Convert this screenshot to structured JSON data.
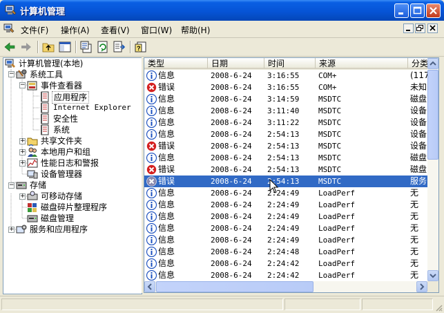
{
  "window": {
    "title": "计算机管理"
  },
  "menu": {
    "items": [
      "文件(F)",
      "操作(A)",
      "查看(V)",
      "窗口(W)",
      "帮助(H)"
    ]
  },
  "tree": {
    "nodes": [
      {
        "label": "计算机管理(本地)",
        "icon": "computer-management-icon"
      },
      {
        "label": "系统工具",
        "icon": "tools-icon"
      },
      {
        "label": "事件查看器",
        "icon": "event-viewer-icon"
      },
      {
        "label": "应用程序",
        "icon": "log-icon"
      },
      {
        "label": "Internet Explorer",
        "icon": "log-icon"
      },
      {
        "label": "安全性",
        "icon": "log-icon"
      },
      {
        "label": "系统",
        "icon": "log-icon"
      },
      {
        "label": "共享文件夹",
        "icon": "shared-folder-icon"
      },
      {
        "label": "本地用户和组",
        "icon": "users-icon"
      },
      {
        "label": "性能日志和警报",
        "icon": "performance-icon"
      },
      {
        "label": "设备管理器",
        "icon": "device-manager-icon"
      },
      {
        "label": "存储",
        "icon": "storage-icon"
      },
      {
        "label": "可移动存储",
        "icon": "removable-storage-icon"
      },
      {
        "label": "磁盘碎片整理程序",
        "icon": "defrag-icon"
      },
      {
        "label": "磁盘管理",
        "icon": "disk-icon"
      },
      {
        "label": "服务和应用程序",
        "icon": "services-icon"
      }
    ]
  },
  "list": {
    "columns": [
      "类型",
      "日期",
      "时间",
      "来源",
      "分类"
    ],
    "rows": [
      {
        "type": "信息",
        "date": "2008-6-24",
        "time": "3:16:55",
        "source": "COM+",
        "category": "(117",
        "kind": "info"
      },
      {
        "type": "错误",
        "date": "2008-6-24",
        "time": "3:16:55",
        "source": "COM+",
        "category": "未知",
        "kind": "error"
      },
      {
        "type": "信息",
        "date": "2008-6-24",
        "time": "3:14:59",
        "source": "MSDTC",
        "category": "磁盘",
        "kind": "info"
      },
      {
        "type": "信息",
        "date": "2008-6-24",
        "time": "3:11:40",
        "source": "MSDTC",
        "category": "设备",
        "kind": "info"
      },
      {
        "type": "信息",
        "date": "2008-6-24",
        "time": "3:11:22",
        "source": "MSDTC",
        "category": "设备",
        "kind": "info"
      },
      {
        "type": "信息",
        "date": "2008-6-24",
        "time": "2:54:13",
        "source": "MSDTC",
        "category": "设备",
        "kind": "info"
      },
      {
        "type": "错误",
        "date": "2008-6-24",
        "time": "2:54:13",
        "source": "MSDTC",
        "category": "设备",
        "kind": "error"
      },
      {
        "type": "信息",
        "date": "2008-6-24",
        "time": "2:54:13",
        "source": "MSDTC",
        "category": "磁盘",
        "kind": "info"
      },
      {
        "type": "错误",
        "date": "2008-6-24",
        "time": "2:54:13",
        "source": "MSDTC",
        "category": "磁盘",
        "kind": "error"
      },
      {
        "type": "错误",
        "date": "2008-6-24",
        "time": "2:54:13",
        "source": "MSDTC",
        "category": "服务",
        "kind": "error-selected"
      },
      {
        "type": "信息",
        "date": "2008-6-24",
        "time": "2:24:49",
        "source": "LoadPerf",
        "category": "无",
        "kind": "info"
      },
      {
        "type": "信息",
        "date": "2008-6-24",
        "time": "2:24:49",
        "source": "LoadPerf",
        "category": "无",
        "kind": "info"
      },
      {
        "type": "信息",
        "date": "2008-6-24",
        "time": "2:24:49",
        "source": "LoadPerf",
        "category": "无",
        "kind": "info"
      },
      {
        "type": "信息",
        "date": "2008-6-24",
        "time": "2:24:49",
        "source": "LoadPerf",
        "category": "无",
        "kind": "info"
      },
      {
        "type": "信息",
        "date": "2008-6-24",
        "time": "2:24:49",
        "source": "LoadPerf",
        "category": "无",
        "kind": "info"
      },
      {
        "type": "信息",
        "date": "2008-6-24",
        "time": "2:24:48",
        "source": "LoadPerf",
        "category": "无",
        "kind": "info"
      },
      {
        "type": "信息",
        "date": "2008-6-24",
        "time": "2:24:42",
        "source": "LoadPerf",
        "category": "无",
        "kind": "info"
      },
      {
        "type": "信息",
        "date": "2008-6-24",
        "time": "2:24:42",
        "source": "LoadPerf",
        "category": "无",
        "kind": "info"
      }
    ]
  },
  "colors": {
    "title_bar": "#0654d6",
    "selection": "#316ac5",
    "info_icon": "#1a4fbf",
    "error_icon": "#d42020"
  }
}
